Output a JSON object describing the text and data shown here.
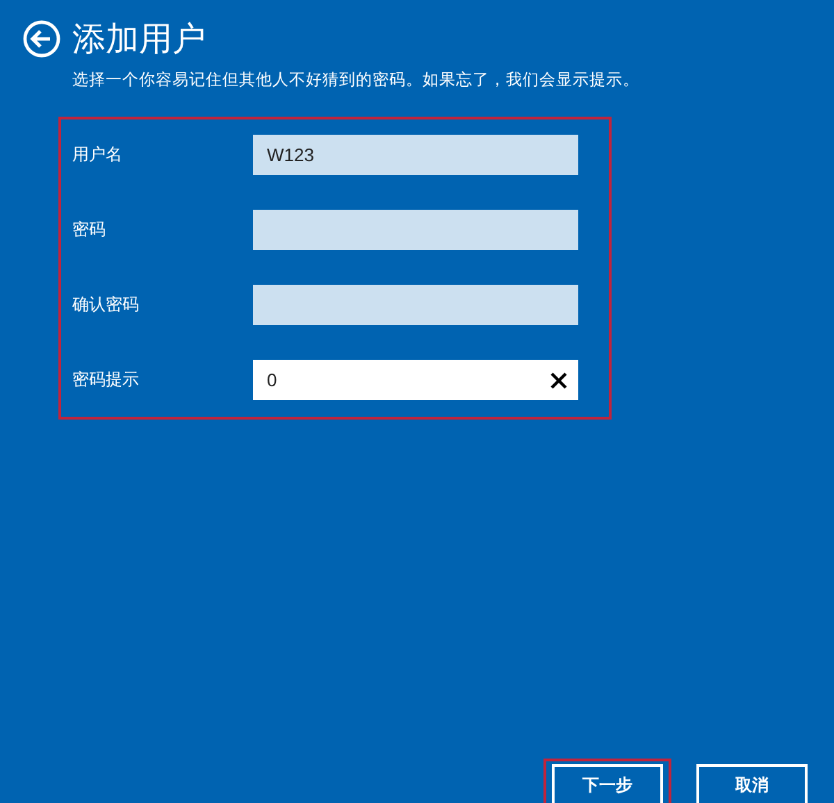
{
  "header": {
    "title": "添加用户",
    "subtitle": "选择一个你容易记住但其他人不好猜到的密码。如果忘了，我们会显示提示。"
  },
  "fields": [
    {
      "label": "用户名",
      "value": "W123",
      "focused": false
    },
    {
      "label": "密码",
      "focused": false
    },
    {
      "label": "确认密码",
      "focused": false
    },
    {
      "label": "密码提示",
      "value": "0",
      "focused": true
    }
  ],
  "buttons": [
    {
      "label": "下一步",
      "highlighted": true
    },
    {
      "label": "取消",
      "highlighted": false
    }
  ]
}
